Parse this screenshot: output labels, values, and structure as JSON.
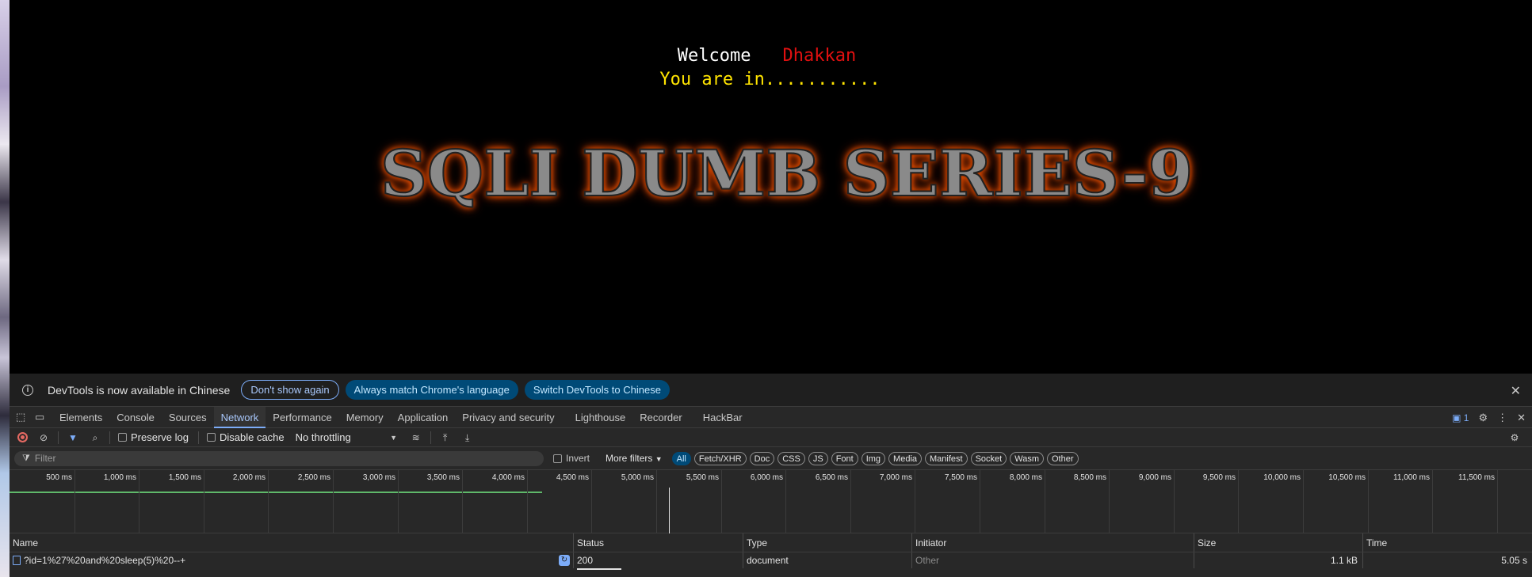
{
  "page": {
    "welcome": "Welcome",
    "username": "Dhakkan",
    "you_are_in": "You are in...........",
    "title_image_text": "SQLI DUMB SERIES-9"
  },
  "infobar": {
    "message": "DevTools is now available in Chinese",
    "dont_show": "Don't show again",
    "always_match": "Always match Chrome's language",
    "switch": "Switch DevTools to Chinese"
  },
  "tabs": [
    {
      "label": "Elements"
    },
    {
      "label": "Console"
    },
    {
      "label": "Sources"
    },
    {
      "label": "Network"
    },
    {
      "label": "Performance"
    },
    {
      "label": "Memory"
    },
    {
      "label": "Application"
    },
    {
      "label": "Privacy and security"
    },
    {
      "label": "Lighthouse"
    },
    {
      "label": "Recorder"
    },
    {
      "label": "HackBar"
    }
  ],
  "issues_count": "1",
  "toolbar": {
    "preserve_log": "Preserve log",
    "disable_cache": "Disable cache",
    "throttling": "No throttling"
  },
  "filterbar": {
    "placeholder": "Filter",
    "invert": "Invert",
    "more_filters": "More filters",
    "chips": [
      "All",
      "Fetch/XHR",
      "Doc",
      "CSS",
      "JS",
      "Font",
      "Img",
      "Media",
      "Manifest",
      "Socket",
      "Wasm",
      "Other"
    ]
  },
  "timeline_ticks": [
    "500 ms",
    "1,000 ms",
    "1,500 ms",
    "2,000 ms",
    "2,500 ms",
    "3,000 ms",
    "3,500 ms",
    "4,000 ms",
    "4,500 ms",
    "5,000 ms",
    "5,500 ms",
    "6,000 ms",
    "6,500 ms",
    "7,000 ms",
    "7,500 ms",
    "8,000 ms",
    "8,500 ms",
    "9,000 ms",
    "9,500 ms",
    "10,000 ms",
    "10,500 ms",
    "11,000 ms",
    "11,500 ms"
  ],
  "columns": {
    "name": "Name",
    "status": "Status",
    "type": "Type",
    "initiator": "Initiator",
    "size": "Size",
    "time": "Time"
  },
  "rows": [
    {
      "name": "?id=1%27%20and%20sleep(5)%20--+",
      "status": "200",
      "type": "document",
      "initiator": "Other",
      "size": "1.1 kB",
      "time": "5.05 s"
    }
  ],
  "colors": {
    "accent": "#7cacf8",
    "username_red": "#e01010",
    "you_are_in_yellow": "#ffe400",
    "title_glow": "#ff5a00"
  }
}
